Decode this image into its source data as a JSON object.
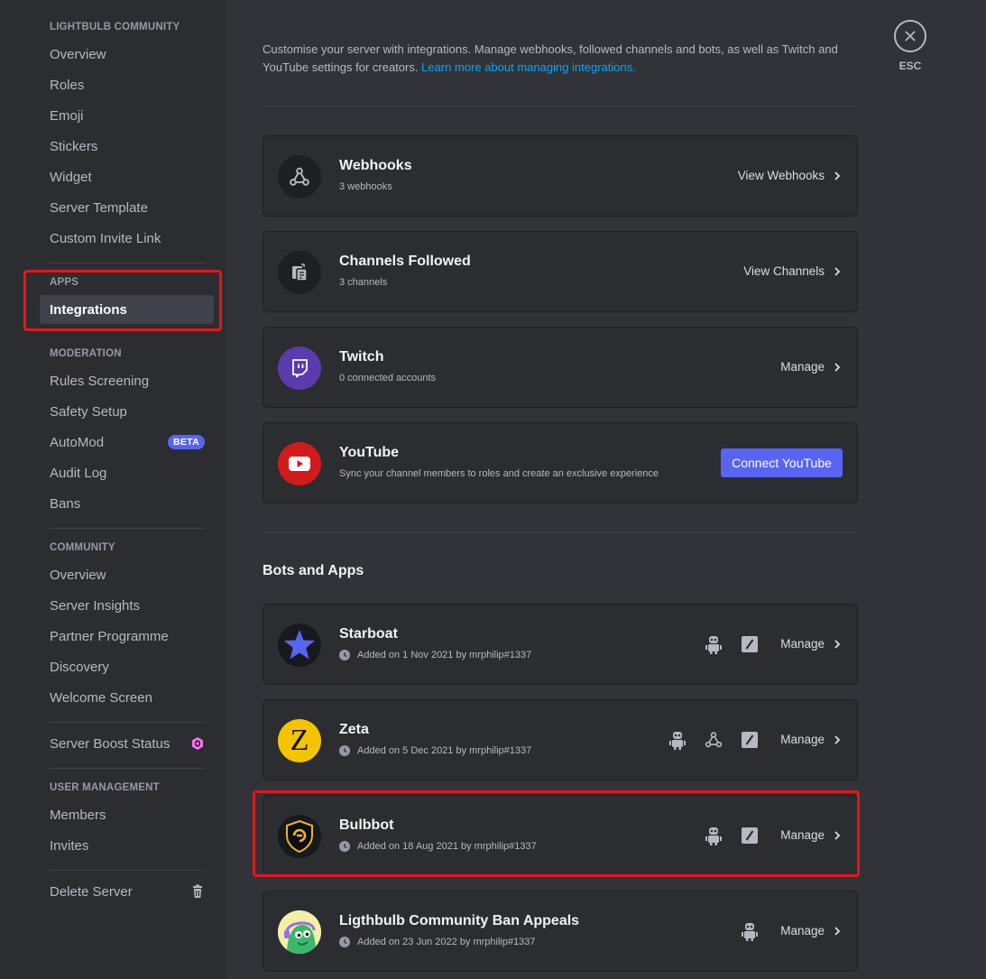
{
  "sidebar": {
    "sections": {
      "server": "LIGHTBULB COMMUNITY",
      "apps": "APPS",
      "moderation": "MODERATION",
      "community": "COMMUNITY",
      "user_management": "USER MANAGEMENT"
    },
    "server_items": [
      "Overview",
      "Roles",
      "Emoji",
      "Stickers",
      "Widget",
      "Server Template",
      "Custom Invite Link"
    ],
    "apps_items": [
      "Integrations"
    ],
    "moderation_items": [
      "Rules Screening",
      "Safety Setup",
      "AutoMod",
      "Audit Log",
      "Bans"
    ],
    "automod_badge": "BETA",
    "community_items": [
      "Overview",
      "Server Insights",
      "Partner Programme",
      "Discovery",
      "Welcome Screen"
    ],
    "boost_item": "Server Boost Status",
    "user_items": [
      "Members",
      "Invites"
    ],
    "delete_item": "Delete Server"
  },
  "main": {
    "description": "Customise your server with integrations. Manage webhooks, followed channels and bots, as well as Twitch and YouTube settings for creators.",
    "description_link": "Learn more about managing integrations.",
    "close_label": "ESC",
    "integrations": [
      {
        "title": "Webhooks",
        "sub": "3 webhooks",
        "action": "View Webhooks",
        "icon": "webhook-icon"
      },
      {
        "title": "Channels Followed",
        "sub": "3 channels",
        "action": "View Channels",
        "icon": "channel-follow-icon"
      },
      {
        "title": "Twitch",
        "sub": "0 connected accounts",
        "action": "Manage",
        "icon": "twitch-icon"
      },
      {
        "title": "YouTube",
        "sub": "Sync your channel members to roles and create an exclusive experience",
        "action": "Connect YouTube",
        "icon": "youtube-icon"
      }
    ],
    "bots_title": "Bots and Apps",
    "bots": [
      {
        "title": "Starboat",
        "sub": "Added on 1 Nov 2021 by mrphilip#1337",
        "action": "Manage"
      },
      {
        "title": "Zeta",
        "sub": "Added on 5 Dec 2021 by mrphilip#1337",
        "action": "Manage",
        "avatar_letter": "Z"
      },
      {
        "title": "Bulbbot",
        "sub": "Added on 18 Aug 2021 by mrphilip#1337",
        "action": "Manage"
      },
      {
        "title": "Ligthbulb Community Ban Appeals",
        "sub": "Added on 23 Jun 2022 by mrphilip#1337",
        "action": "Manage"
      }
    ]
  },
  "colors": {
    "accent": "#5865f2",
    "highlight": "#e8141b",
    "twitch": "#5c3bad",
    "youtube": "#d21b1b",
    "boost": "#ff73fa"
  }
}
